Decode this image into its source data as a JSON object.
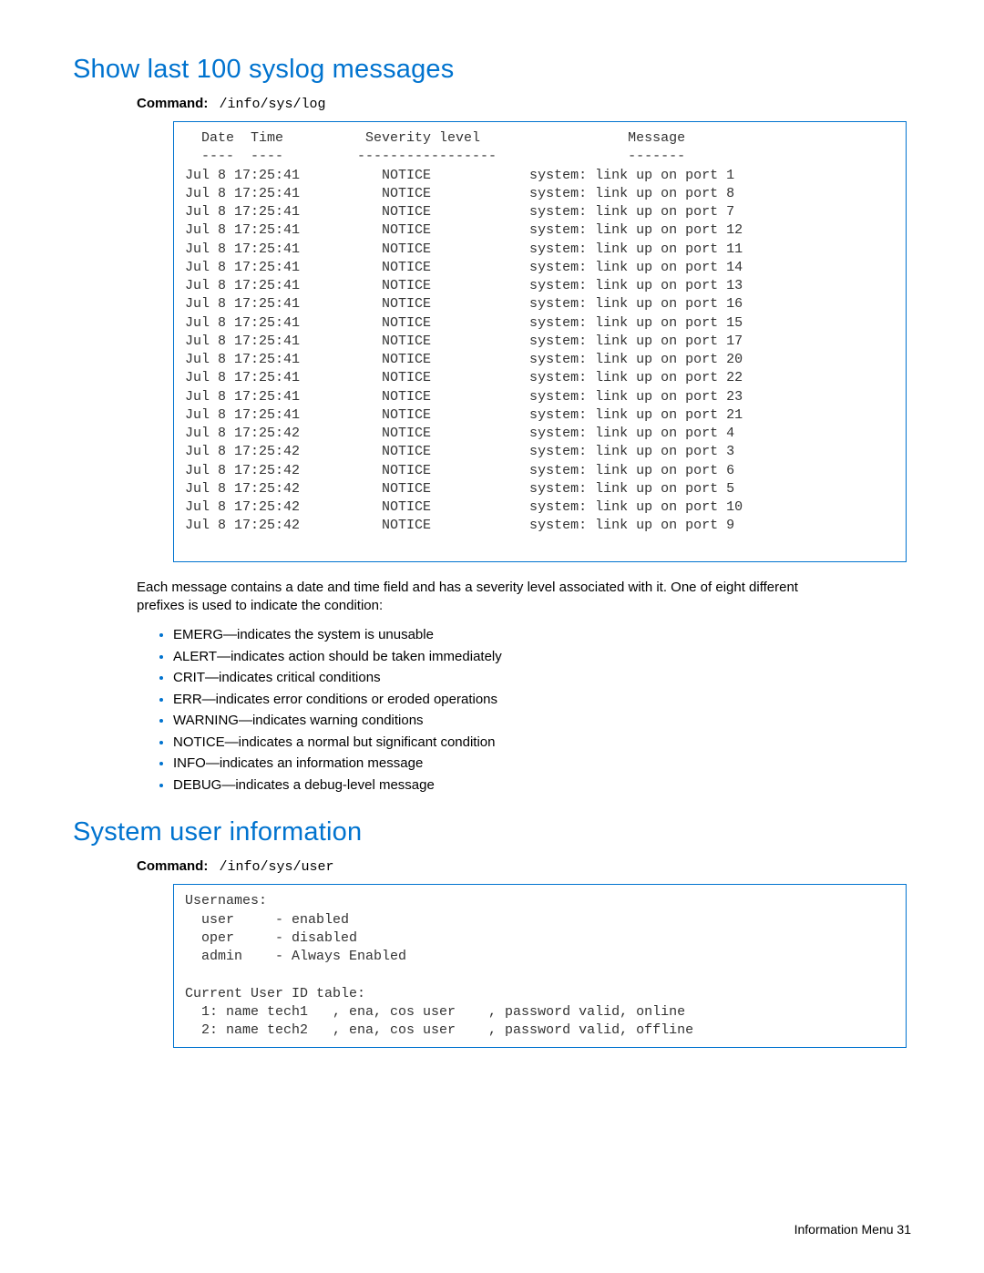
{
  "section1": {
    "title": "Show last 100 syslog messages",
    "command_label": "Command:",
    "command": "/info/sys/log",
    "log_header": "  Date  Time          Severity level                  Message\n  ----  ----         -----------------                -------",
    "log_rows": [
      "Jul 8 17:25:41          NOTICE            system: link up on port 1",
      "Jul 8 17:25:41          NOTICE            system: link up on port 8",
      "Jul 8 17:25:41          NOTICE            system: link up on port 7",
      "Jul 8 17:25:41          NOTICE            system: link up on port 12",
      "Jul 8 17:25:41          NOTICE            system: link up on port 11",
      "Jul 8 17:25:41          NOTICE            system: link up on port 14",
      "Jul 8 17:25:41          NOTICE            system: link up on port 13",
      "Jul 8 17:25:41          NOTICE            system: link up on port 16",
      "Jul 8 17:25:41          NOTICE            system: link up on port 15",
      "Jul 8 17:25:41          NOTICE            system: link up on port 17",
      "Jul 8 17:25:41          NOTICE            system: link up on port 20",
      "Jul 8 17:25:41          NOTICE            system: link up on port 22",
      "Jul 8 17:25:41          NOTICE            system: link up on port 23",
      "Jul 8 17:25:41          NOTICE            system: link up on port 21",
      "Jul 8 17:25:42          NOTICE            system: link up on port 4",
      "Jul 8 17:25:42          NOTICE            system: link up on port 3",
      "Jul 8 17:25:42          NOTICE            system: link up on port 6",
      "Jul 8 17:25:42          NOTICE            system: link up on port 5",
      "Jul 8 17:25:42          NOTICE            system: link up on port 10",
      "Jul 8 17:25:42          NOTICE            system: link up on port 9"
    ],
    "paragraph": "Each message contains a date and time field and has a severity level associated with it. One of eight different prefixes is used to indicate the condition:",
    "bullets": [
      "EMERG—indicates the system is unusable",
      "ALERT—indicates action should be taken immediately",
      "CRIT—indicates critical conditions",
      "ERR—indicates error conditions or eroded operations",
      "WARNING—indicates warning conditions",
      "NOTICE—indicates a normal but significant condition",
      "INFO—indicates an information message",
      "DEBUG—indicates a debug-level message"
    ]
  },
  "section2": {
    "title": "System user information",
    "command_label": "Command:",
    "command": "/info/sys/user",
    "userbox": "Usernames:\n  user     - enabled\n  oper     - disabled\n  admin    - Always Enabled\n\nCurrent User ID table:\n  1: name tech1   , ena, cos user    , password valid, online\n  2: name tech2   , ena, cos user    , password valid, offline"
  },
  "footer": {
    "text": "Information Menu   31"
  }
}
